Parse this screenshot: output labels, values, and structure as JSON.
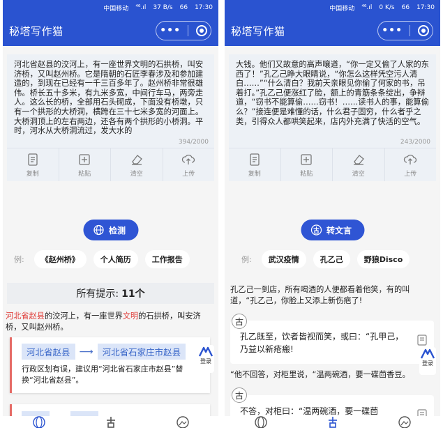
{
  "status": {
    "carrier": "中国移动",
    "signal": "⁴⁶.ıl",
    "left_speed": "37 B/s",
    "right_speed": "0 K/s",
    "battery": "66",
    "time": "17:30"
  },
  "app": {
    "title": "秘塔写作猫",
    "menu_glyph": "•••"
  },
  "left": {
    "editor_text": "河北省赵县的洨河上，有一座世界文明的石拱桥，叫安济桥，又叫赵州桥。它是隋朝的石匠李春涉及和参加建造的，到现在已经有一千三百多年了。赵州桥非常很雄伟。桥长五十多米，有九米多宽，中间行车马，两旁走人。这么长的桥，全部用石头砌成，下面没有桥墩，只有一个拱形的大桥洞，横跨在三十七米多宽的河面上。大桥洞顶上的左右两边，还各有两个拱形的小桥洞。平时，河水从大桥洞流过，发大水的",
    "counter": "394/2000",
    "tools": [
      "复制",
      "粘贴",
      "清空",
      "上传"
    ],
    "action_label": "检测",
    "example_label": "例:",
    "examples": [
      "《赵州桥》",
      "个人简历",
      "工作报告"
    ],
    "hints_title": "所有提示:",
    "hints_count": "11个",
    "preview_err": "河北省赵县",
    "preview_mid": "的洨河上，有一座世界",
    "preview_err2": "文明",
    "preview_rest": "的石拱桥，叫安济桥，又叫赵州桥。",
    "hint_old": "河北省赵县",
    "hint_arrow": "⟶",
    "hint_new": "河北省石家庄市赵县",
    "hint_desc": "行政区划有误，建议用“河北省石家庄市赵县”替换“河北省赵县”。",
    "login_label": "登录"
  },
  "right": {
    "editor_text": "大钱。他们又故意的高声嚷道，“你一定又偷了人家的东西了！”孔乙己睁大眼睛说，“你怎么这样凭空污人清白……”“什么清白？我前天亲眼见你偷了何家的书，吊着打。”孔乙己便涨红了脸，额上的青筋条条绽出，争辩道，“窃书不能算偷……窃书！……读书人的事，能算偷么？”接连便是难懂的话，什么君子固穷，什么者乎之类，引得众人都哄笑起来，店内外充满了快活的空气。",
    "counter": "243/2000",
    "tools": [
      "复制",
      "粘贴",
      "清空",
      "上传"
    ],
    "action_label": "转文言",
    "example_label": "例:",
    "examples": [
      "武汉疫情",
      "孔乙己",
      "野狼Disco"
    ],
    "story_text": "孔乙己一到店，所有喝酒的人便都看着他笑，有的叫道，“孔乙己，你脸上又添上新伤疤了!",
    "ancient_glyph": "古",
    "quote1": "孔乙既至，饮者皆视而笑，或曰：“孔甲己，乃益以新疮瘢!",
    "reply_text": "“他不回答，对柜里说，“温两碗酒，要一碟茴香豆。",
    "quote2": "不答，对柜曰：“温两碗酒，要一碟茴",
    "login_label": "登录"
  },
  "colors": {
    "brand": "#2a53d0",
    "button": "#2f55d4",
    "error": "#e0403c",
    "suggest_bg": "#dbe5f8"
  }
}
